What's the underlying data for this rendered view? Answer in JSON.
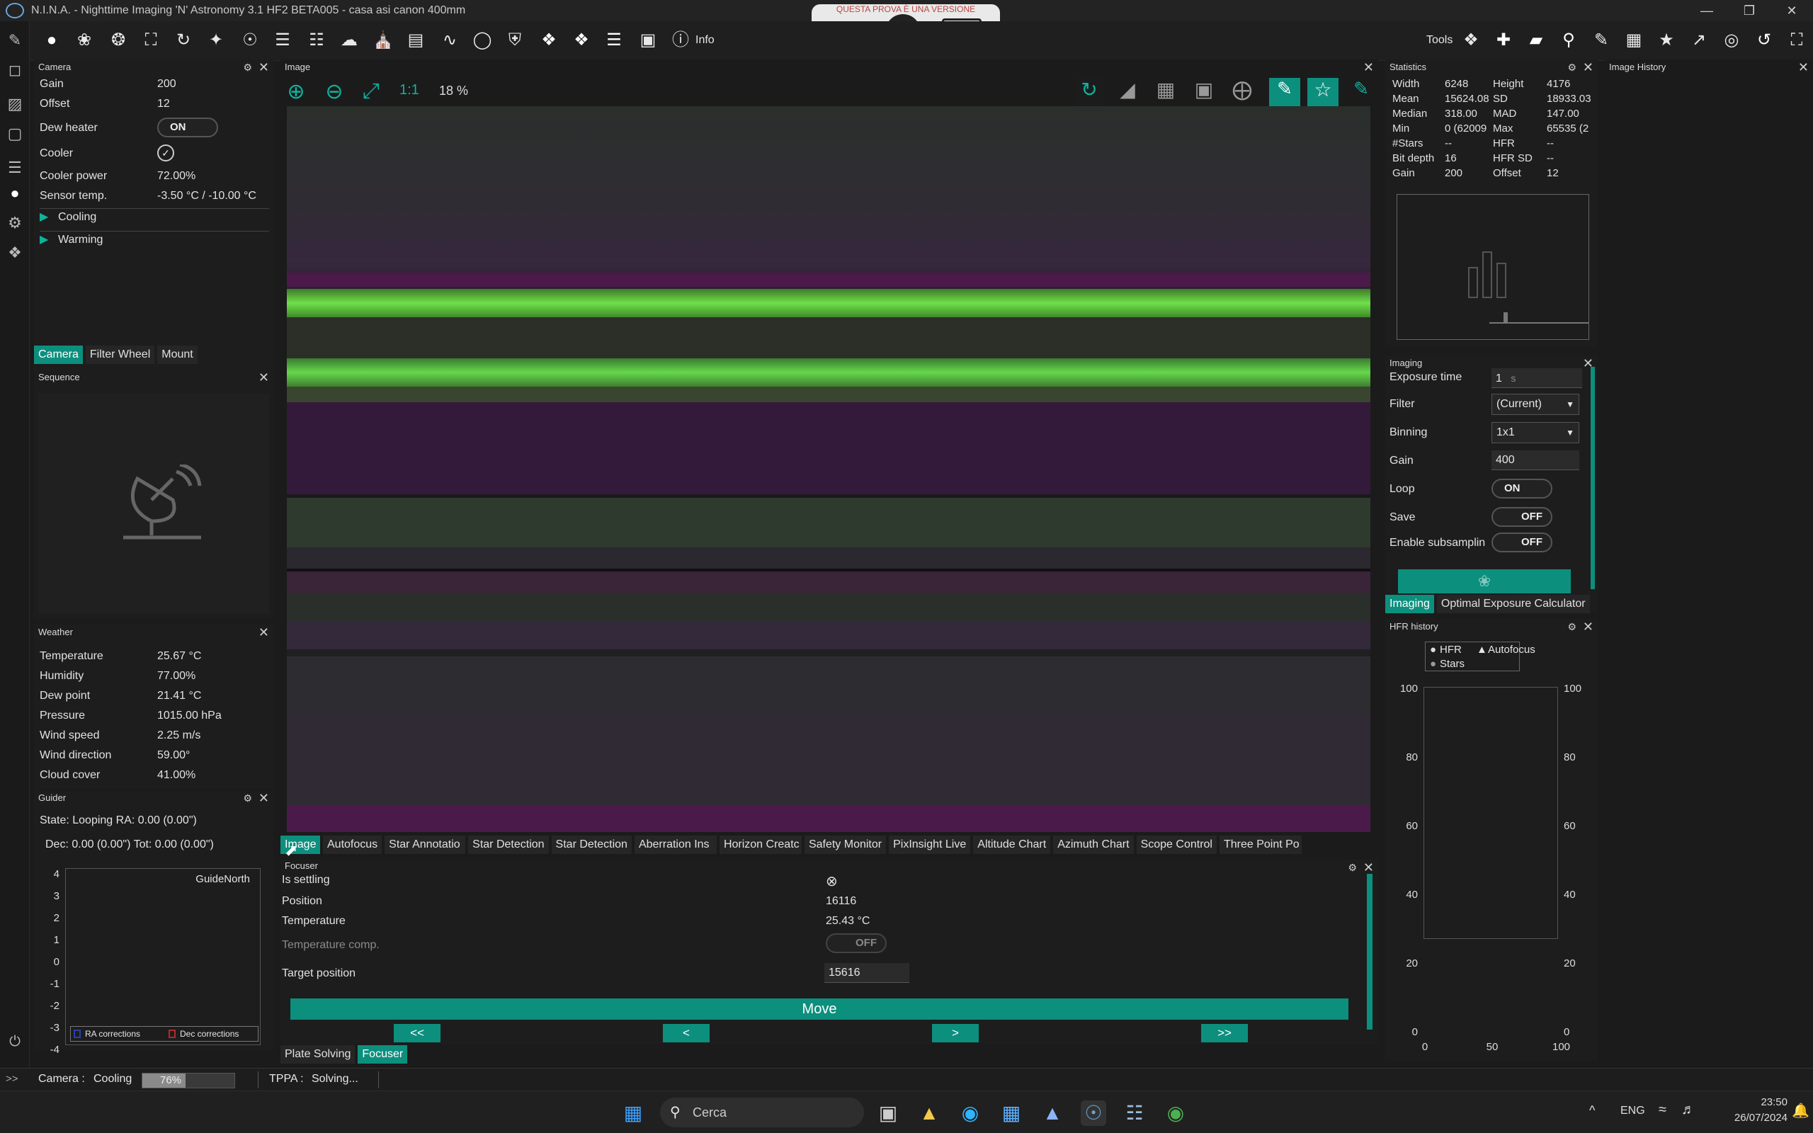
{
  "window": {
    "title": "N.I.N.A. - Nighttime Imaging 'N' Astronomy 3.1 HF2 BETA005  -  casa asi canon 400mm",
    "overlay_banner": "QUESTA PROVA È UNA VERSIONE"
  },
  "toolbar": {
    "info_label": "Info",
    "tools_label": "Tools"
  },
  "camera_panel": {
    "title": "Camera",
    "rows": [
      {
        "label": "Gain",
        "value": "200"
      },
      {
        "label": "Offset",
        "value": "12"
      },
      {
        "label": "Dew heater",
        "value": "ON"
      },
      {
        "label": "Cooler",
        "value": "✓"
      },
      {
        "label": "Cooler power",
        "value": "72.00%"
      },
      {
        "label": "Sensor temp.",
        "value": "-3.50 °C / -10.00 °C"
      }
    ],
    "expanders": [
      "Cooling",
      "Warming"
    ],
    "tabs": [
      "Camera",
      "Filter Wheel",
      "Mount"
    ]
  },
  "sequence_panel": {
    "title": "Sequence"
  },
  "weather_panel": {
    "title": "Weather",
    "rows": [
      {
        "label": "Temperature",
        "value": "25.67 °C"
      },
      {
        "label": "Humidity",
        "value": "77.00%"
      },
      {
        "label": "Dew point",
        "value": "21.41 °C"
      },
      {
        "label": "Pressure",
        "value": "1015.00 hPa"
      },
      {
        "label": "Wind speed",
        "value": "2.25 m/s"
      },
      {
        "label": "Wind direction",
        "value": "59.00°"
      },
      {
        "label": "Cloud cover",
        "value": "41.00%"
      }
    ]
  },
  "guider_panel": {
    "title": "Guider",
    "state": "State: Looping  RA: 0.00 (0.00\")",
    "dec": "Dec: 0.00 (0.00\")  Tot: 0.00 (0.00\")",
    "chart_label": "GuideNorth",
    "y_ticks": [
      "4",
      "3",
      "2",
      "1",
      "0",
      "-1",
      "-2",
      "-3",
      "-4"
    ],
    "legend_ra": "RA corrections",
    "legend_dec": "Dec corrections"
  },
  "image_panel": {
    "title": "Image",
    "zoom_fit_label": "1:1",
    "zoom_percent": "18 %"
  },
  "bottom_tabs": [
    "Image",
    "Autofocus",
    "Star Annotatio",
    "Star Detection",
    "Star Detection",
    "Aberration Ins",
    "Horizon Creatc",
    "Safety Monitor",
    "PixInsight Live",
    "Altitude Chart",
    "Azimuth Chart",
    "Scope Control",
    "Three Point Po"
  ],
  "focuser_panel": {
    "title": "Focuser",
    "rows": [
      {
        "label": "Is settling",
        "value": "⊗"
      },
      {
        "label": "Position",
        "value": "16116"
      },
      {
        "label": "Temperature",
        "value": "25.43 °C"
      },
      {
        "label": "Temperature comp.",
        "value": "OFF"
      },
      {
        "label": "Target position",
        "value": "15616"
      }
    ],
    "move_label": "Move",
    "step_buttons": [
      "<<",
      "<",
      ">",
      ">>"
    ],
    "tabs": [
      "Plate Solving",
      "Focuser"
    ]
  },
  "statistics_panel": {
    "title": "Statistics",
    "rows": [
      {
        "k1": "Width",
        "v1": "6248",
        "k2": "Height",
        "v2": "4176"
      },
      {
        "k1": "Mean",
        "v1": "15624.08",
        "k2": "SD",
        "v2": "18933.03"
      },
      {
        "k1": "Median",
        "v1": "318.00",
        "k2": "MAD",
        "v2": "147.00"
      },
      {
        "k1": "Min",
        "v1": "0 (62009",
        "k2": "Max",
        "v2": "65535 (2"
      },
      {
        "k1": "#Stars",
        "v1": "--",
        "k2": "HFR",
        "v2": "--"
      },
      {
        "k1": "Bit depth",
        "v1": "16",
        "k2": "HFR SD",
        "v2": "--"
      },
      {
        "k1": "Gain",
        "v1": "200",
        "k2": "Offset",
        "v2": "12"
      }
    ]
  },
  "image_history_panel": {
    "title": "Image History"
  },
  "imaging_panel": {
    "title": "Imaging",
    "exposure_label": "Exposure time",
    "exposure_value": "1",
    "exposure_unit": "s",
    "filter_label": "Filter",
    "filter_value": "(Current)",
    "binning_label": "Binning",
    "binning_value": "1x1",
    "gain_label": "Gain",
    "gain_value": "400",
    "loop_label": "Loop",
    "loop_value": "ON",
    "save_label": "Save",
    "save_value": "OFF",
    "subsampling_label": "Enable subsamplin",
    "subsampling_value": "OFF",
    "tabs": [
      "Imaging",
      "Optimal Exposure Calculator"
    ]
  },
  "hfr_panel": {
    "title": "HFR history",
    "legend": [
      "HFR",
      "Autofocus",
      "Stars"
    ],
    "y_ticks": [
      "100",
      "80",
      "60",
      "40",
      "20",
      "0"
    ],
    "x_ticks": [
      "0",
      "50",
      "100"
    ]
  },
  "statusbar": {
    "prefix": ">>",
    "camera_label": "Camera :",
    "camera_status": "Cooling",
    "progress_text": "76%",
    "progress_value": 0.76,
    "tppa_label": "TPPA :",
    "tppa_status": "Solving..."
  },
  "taskbar": {
    "search_placeholder": "Cerca",
    "lang": "ENG",
    "time": "23:50",
    "date": "26/07/2024"
  },
  "remote_toolbar": {
    "icons": [
      "zoom-in-icon",
      "remote-connect-icon",
      "keyboard-icon"
    ]
  }
}
